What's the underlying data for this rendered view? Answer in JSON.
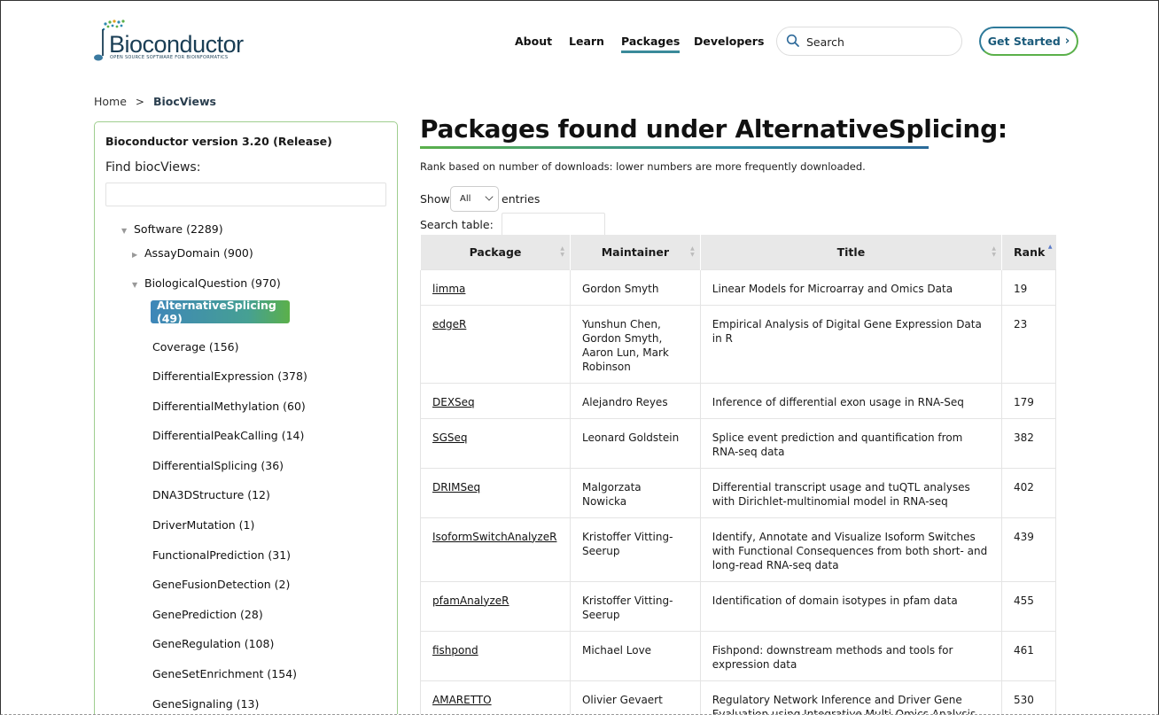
{
  "header": {
    "logo_text": "Bioconductor",
    "logo_tagline": "OPEN SOURCE SOFTWARE FOR BIOINFORMATICS",
    "nav": [
      "About",
      "Learn",
      "Packages",
      "Developers"
    ],
    "active_nav": "Packages",
    "search_placeholder": "Search",
    "get_started": "Get Started"
  },
  "breadcrumb": {
    "home": "Home",
    "current": "BiocViews"
  },
  "sidebar": {
    "version": "Bioconductor version 3.20 (Release)",
    "find_label": "Find biocViews:",
    "software": "Software (2289)",
    "assay_domain": "AssayDomain (900)",
    "biological_question": "BiologicalQuestion (970)",
    "selected": "AlternativeSplicing (49)",
    "children": [
      "Coverage (156)",
      "DifferentialExpression (378)",
      "DifferentialMethylation (60)",
      "DifferentialPeakCalling (14)",
      "DifferentialSplicing (36)",
      "DNA3DStructure (12)",
      "DriverMutation (1)",
      "FunctionalPrediction (31)",
      "GeneFusionDetection (2)",
      "GenePrediction (28)",
      "GeneRegulation (108)",
      "GeneSetEnrichment (154)",
      "GeneSignaling (13)"
    ]
  },
  "main": {
    "title": "Packages found under AlternativeSplicing:",
    "rank_note": "Rank based on number of downloads: lower numbers are more frequently downloaded.",
    "show_label": "Show",
    "entries_value": "All",
    "entries_label": "entries",
    "search_table_label": "Search table:",
    "columns": [
      "Package",
      "Maintainer",
      "Title",
      "Rank"
    ],
    "rows": [
      {
        "package": "limma",
        "maintainer": "Gordon Smyth",
        "title": "Linear Models for Microarray and Omics Data",
        "rank": "19"
      },
      {
        "package": "edgeR",
        "maintainer": "Yunshun Chen, Gordon Smyth, Aaron Lun, Mark Robinson",
        "title": "Empirical Analysis of Digital Gene Expression Data in R",
        "rank": "23"
      },
      {
        "package": "DEXSeq",
        "maintainer": "Alejandro Reyes",
        "title": "Inference of differential exon usage in RNA-Seq",
        "rank": "179"
      },
      {
        "package": "SGSeq",
        "maintainer": "Leonard Goldstein",
        "title": "Splice event prediction and quantification from RNA-seq data",
        "rank": "382"
      },
      {
        "package": "DRIMSeq",
        "maintainer": "Malgorzata Nowicka",
        "title": "Differential transcript usage and tuQTL analyses with Dirichlet-multinomial model in RNA-seq",
        "rank": "402"
      },
      {
        "package": "IsoformSwitchAnalyzeR",
        "maintainer": "Kristoffer Vitting-Seerup",
        "title": "Identify, Annotate and Visualize Isoform Switches with Functional Consequences from both short- and long-read RNA-seq data",
        "rank": "439"
      },
      {
        "package": "pfamAnalyzeR",
        "maintainer": "Kristoffer Vitting-Seerup",
        "title": "Identification of domain isotypes in pfam data",
        "rank": "455"
      },
      {
        "package": "fishpond",
        "maintainer": "Michael Love",
        "title": "Fishpond: downstream methods and tools for expression data",
        "rank": "461"
      },
      {
        "package": "AMARETTO",
        "maintainer": "Olivier Gevaert",
        "title": "Regulatory Network Inference and Driver Gene Evaluation using Integrative Multi-Omics Analysis and",
        "rank": "530"
      }
    ]
  }
}
